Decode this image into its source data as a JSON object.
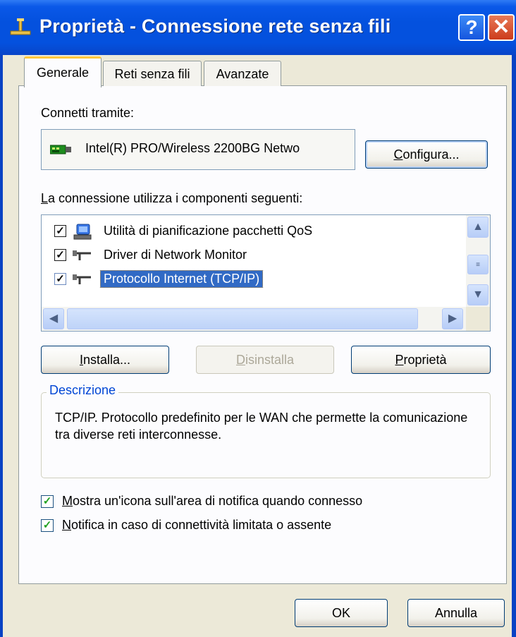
{
  "window": {
    "title": "Proprietà - Connessione rete senza fili",
    "help_label": "?",
    "close_label": "✕"
  },
  "tabs": [
    {
      "label": "Generale",
      "active": true
    },
    {
      "label": "Reti senza fili",
      "active": false
    },
    {
      "label": "Avanzate",
      "active": false
    }
  ],
  "general": {
    "connect_using_label": "Connetti tramite:",
    "adapter_name": "Intel(R) PRO/Wireless 2200BG Netwo",
    "configure": {
      "first": "C",
      "rest": "onfigura..."
    },
    "components_label": {
      "first": "L",
      "rest": "a connessione utilizza i componenti seguenti:"
    },
    "components": [
      {
        "label": "Utilità di pianificazione pacchetti QoS",
        "checked": true,
        "icon": "qos-scheduler-icon"
      },
      {
        "label": "Driver di Network Monitor",
        "checked": true,
        "icon": "network-protocol-icon"
      },
      {
        "label": "Protocollo Internet (TCP/IP)",
        "checked": true,
        "icon": "network-protocol-icon",
        "selected": true
      }
    ],
    "install": {
      "first": "I",
      "rest": "nstalla..."
    },
    "uninstall": {
      "first": "D",
      "rest": "isinstalla"
    },
    "properties": {
      "first": "P",
      "rest": "roprietà"
    },
    "description_title": "Descrizione",
    "description_text": "TCP/IP. Protocollo predefinito per le WAN che permette la comunicazione tra diverse reti interconnesse.",
    "show_icon": {
      "first": "M",
      "rest": "ostra un'icona sull'area di notifica quando connesso",
      "checked": true
    },
    "notify_limited": {
      "first": "N",
      "rest": "otifica in caso di connettività limitata o assente",
      "checked": true
    }
  },
  "footer": {
    "ok_label": "OK",
    "cancel_label": "Annulla"
  },
  "colors": {
    "title_bar": "#0451DE",
    "selection": "#316AC5",
    "group_title": "#0046D5",
    "checkmark": "#21A121"
  }
}
